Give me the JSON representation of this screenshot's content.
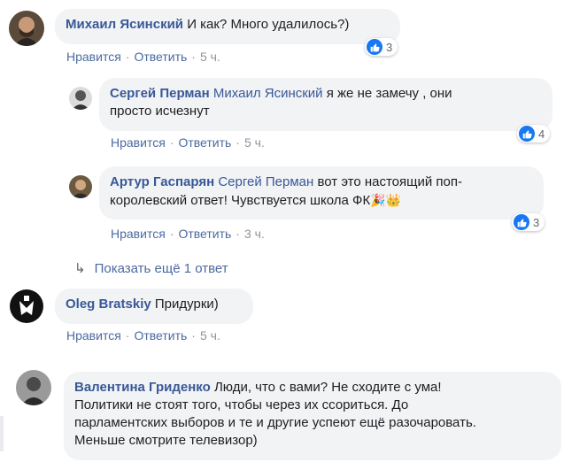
{
  "actions": {
    "like": "Нравится",
    "reply": "Ответить",
    "dot": "·"
  },
  "comments": [
    {
      "author": "Михаил Ясинский",
      "text": "И как? Много удалилось?)",
      "time": "5 ч.",
      "reactions": "3"
    },
    {
      "author": "Сергей Перман",
      "mention": "Михаил Ясинский",
      "text_line1": "я же не замечу , они",
      "text_line2": "просто исчезнут",
      "time": "5 ч.",
      "reactions": "4"
    },
    {
      "author": "Артур Гаспарян",
      "mention": "Сергей Перман",
      "text_line1": "вот это настоящий поп-",
      "text_line2": "королевский ответ! Чувствуется школа ФК",
      "emoji1": "🎉",
      "emoji2": "👑",
      "time": "3 ч.",
      "reactions": "3"
    },
    {
      "author": "Oleg Bratskiy",
      "text": "Придурки)",
      "time": "5 ч."
    },
    {
      "author": "Валентина Гриденко",
      "text_line1": "Люди, что с вами? Не сходите с ума!",
      "text_line2": "Политики не стоят того, чтобы через их ссориться. До",
      "text_line3": "парламентских выборов и те и другие успеют ещё разочаровать.",
      "text_line4": "Меньше смотрите телевизор)"
    }
  ],
  "more_replies": {
    "arrow": "↳",
    "label": "Показать ещё 1 ответ"
  },
  "icons": {
    "like": "thumbs-up-icon",
    "reply_arrow": "reply-arrow-icon"
  },
  "colors": {
    "link": "#385898",
    "bubble": "#f2f3f5",
    "like": "#1877f2",
    "meta_gray": "#90949c"
  }
}
